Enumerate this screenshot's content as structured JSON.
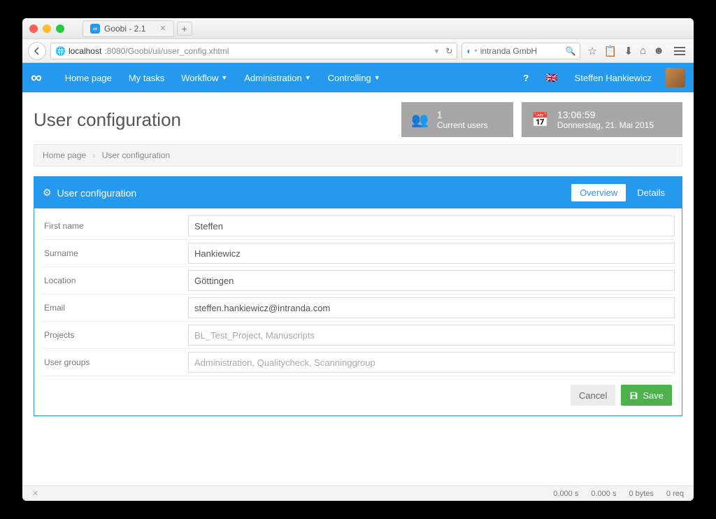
{
  "browser": {
    "tab_title": "Goobi - 2.1",
    "url_host": "localhost",
    "url_path": ":8080/Goobi/uii/user_config.xhtml",
    "search_text": "intranda GmbH"
  },
  "nav": {
    "home": "Home page",
    "tasks": "My tasks",
    "workflow": "Workflow",
    "admin": "Administration",
    "controlling": "Controlling",
    "username": "Steffen Hankiewicz"
  },
  "header": {
    "title": "User configuration",
    "users_count": "1",
    "users_label": "Current users",
    "time": "13:06:59",
    "date": "Donnerstag, 21. Mai 2015"
  },
  "breadcrumb": {
    "home": "Home page",
    "current": "User configuration"
  },
  "panel": {
    "title": "User configuration",
    "tab_overview": "Overview",
    "tab_details": "Details"
  },
  "form": {
    "first_name_label": "First name",
    "first_name_value": "Steffen",
    "surname_label": "Surname",
    "surname_value": "Hankiewicz",
    "location_label": "Location",
    "location_value": "Göttingen",
    "email_label": "Email",
    "email_value": "steffen.hankiewicz@intranda.com",
    "projects_label": "Projects",
    "projects_value": "BL_Test_Project, Manuscripts",
    "groups_label": "User groups",
    "groups_value": "Administration, Qualitycheck, Scanninggroup",
    "cancel": "Cancel",
    "save": "Save"
  },
  "status": {
    "t1": "0.000 s",
    "t2": "0.000 s",
    "bytes": "0 bytes",
    "req": "0 req"
  }
}
